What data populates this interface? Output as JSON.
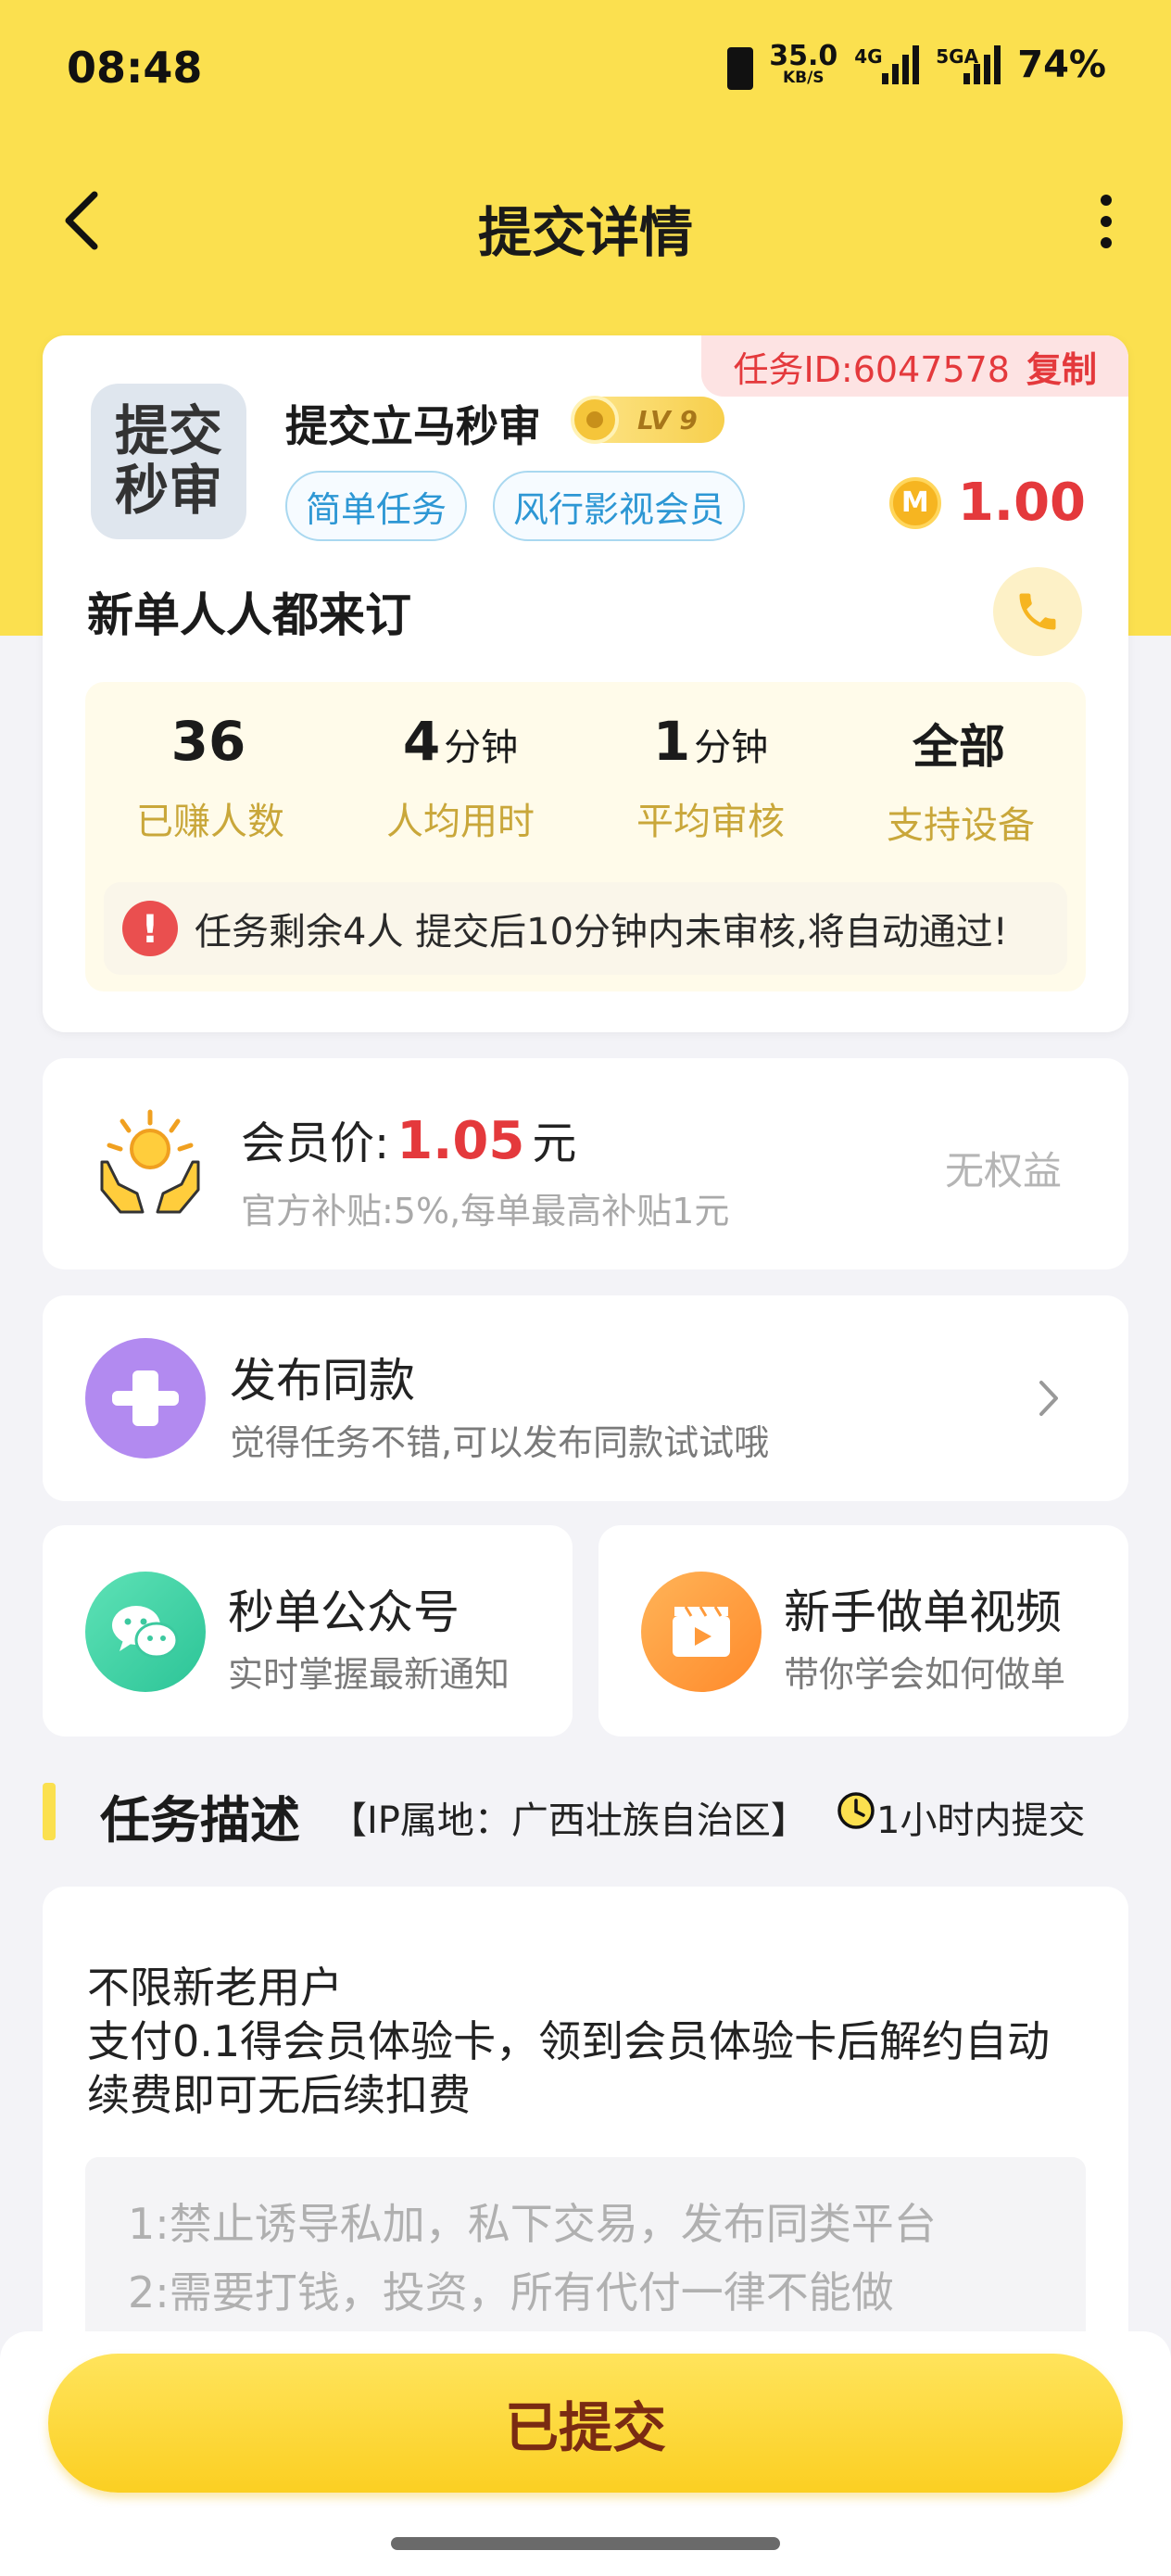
{
  "status_bar": {
    "time": "08:48",
    "net_speed_value": "35.0",
    "net_speed_unit": "KB/S",
    "sig1_label": "4G",
    "sig2_label": "5GA",
    "battery": "74%"
  },
  "nav": {
    "title": "提交详情",
    "back_icon": "chevron-left-icon",
    "more_icon": "more-vertical-icon"
  },
  "task": {
    "id_text": "任务ID:6047578",
    "copy_label": "复制",
    "avatar_text": "提交秒审",
    "name": "提交立马秒审",
    "level": "LV 9",
    "tags": [
      "简单任务",
      "风行影视会员"
    ],
    "price": "1.00",
    "coin_symbol": "M",
    "subtitle": "新单人人都来订",
    "stats": [
      {
        "value": "36",
        "unit": "",
        "label": "已赚人数"
      },
      {
        "value": "4",
        "unit": "分钟",
        "label": "人均用时"
      },
      {
        "value": "1",
        "unit": "分钟",
        "label": "平均审核"
      },
      {
        "value": "全部",
        "unit": "",
        "label": "支持设备"
      }
    ],
    "notice_icon": "!",
    "notice": "任务剩余4人  提交后10分钟内未审核,将自动通过!"
  },
  "member": {
    "label": "会员价:",
    "price": "1.05",
    "unit": "元",
    "sub": "官方补贴:5%,每单最高补贴1元",
    "right": "无权益"
  },
  "publish": {
    "title": "发布同款",
    "sub": "觉得任务不错,可以发布同款试试哦"
  },
  "wechat": {
    "title": "秒单公众号",
    "sub": "实时掌握最新通知"
  },
  "video": {
    "title": "新手做单视频",
    "sub": "带你学会如何做单"
  },
  "section": {
    "title": "任务描述",
    "ip": "【IP属地：广西壮族自治区】",
    "time": "1小时内提交"
  },
  "description": {
    "line1": "不限新老用户",
    "line2": "支付0.1得会员体验卡，领到会员体验卡后解约自动续费即可无后续扣费",
    "rule1": "1:禁止诱导私加，私下交易，发布同类平台",
    "rule2": "2:需要打钱，投资，所有代付一律不能做"
  },
  "submit_label": "已提交",
  "colors": {
    "brand_yellow": "#fbe04f",
    "price_red": "#e4393c",
    "tag_blue": "#2d97d4",
    "stat_gold": "#c9a73a"
  }
}
